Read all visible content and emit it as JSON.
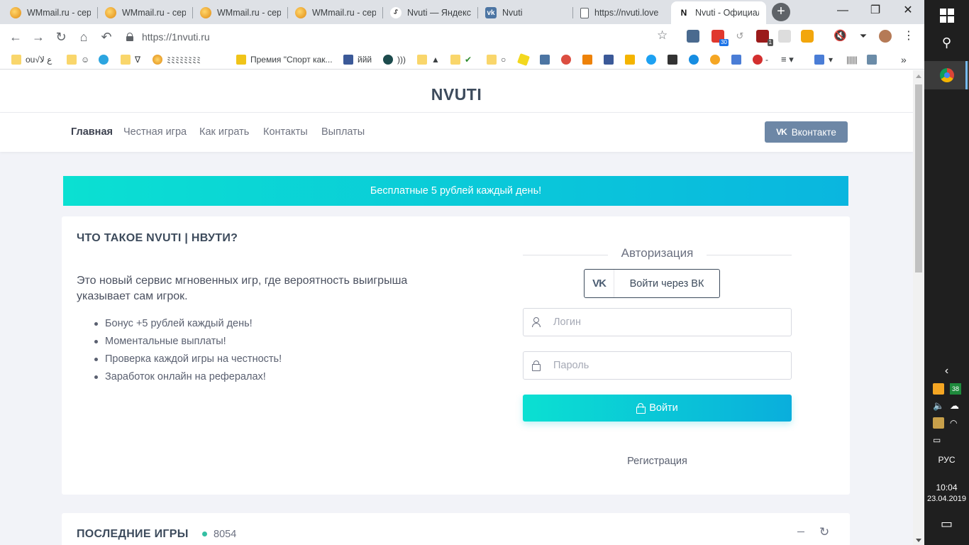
{
  "browser": {
    "tabs": [
      {
        "title": "WMmail.ru - сер",
        "icon": "wmmail-icon"
      },
      {
        "title": "WMmail.ru - сер",
        "icon": "wmmail-icon"
      },
      {
        "title": "WMmail.ru - сер",
        "icon": "wmmail-icon"
      },
      {
        "title": "WMmail.ru - сер",
        "icon": "wmmail-icon"
      },
      {
        "title": "Nvuti — Яндекс",
        "icon": "yandex-icon"
      },
      {
        "title": "Nvuti",
        "icon": "vk-icon"
      },
      {
        "title": "https://nvuti.love",
        "icon": "document-icon"
      },
      {
        "title": "Nvuti - Официал",
        "icon": "nvuti-icon",
        "active": true
      }
    ],
    "new_tab_label": "+",
    "address": "https://1nvuti.ru",
    "extension_badges": {
      "ext2": "30",
      "ext4": "1"
    },
    "bookmarks": [
      {
        "label": "ou√ع ﻻ",
        "icon": "folder-icon"
      },
      {
        "label": "☺",
        "icon": "folder-icon"
      },
      {
        "label": "",
        "icon": "telegram-icon"
      },
      {
        "label": "∇",
        "icon": "folder-icon"
      },
      {
        "label": "ﾐﾐﾐﾐﾐﾐﾐﾐ",
        "icon": "wmmail-icon"
      },
      {
        "label": "Премия \"Спорт как...",
        "icon": "award-icon"
      },
      {
        "label": "ййй",
        "icon": "facebook-icon"
      },
      {
        "label": ")))",
        "icon": "globe-icon"
      },
      {
        "label": "▲",
        "icon": "folder-icon"
      },
      {
        "label": "✔",
        "icon": "folder-icon"
      },
      {
        "label": "○",
        "icon": "folder-icon"
      }
    ]
  },
  "site": {
    "brand": "NVUTI",
    "nav": [
      "Главная",
      "Честная игра",
      "Как играть",
      "Контакты",
      "Выплаты"
    ],
    "vk_button": "Вконтакте",
    "vk_mark": "VK",
    "banner": "Бесплатные 5 рублей каждый день!",
    "about": {
      "title": "ЧТО ТАКОЕ NVUTI | НВУТИ?",
      "intro": "Это новый сервис мгновенных игр, где вероятность выигрыша указывает сам игрок.",
      "features": [
        "Бонус +5 рублей каждый день!",
        "Моментальные выплаты!",
        "Проверка каждой игры на честность!",
        "Заработок онлайн на рефералах!"
      ]
    },
    "auth": {
      "heading": "Авторизация",
      "vk_login": "Войти через ВК",
      "login_placeholder": "Логин",
      "password_placeholder": "Пароль",
      "submit": "Войти",
      "register": "Регистрация"
    },
    "recent_games": {
      "title": "ПОСЛЕДНИЕ ИГРЫ",
      "online_count": "8054"
    }
  },
  "taskbar": {
    "tray_badge": "38",
    "language": "РУС",
    "time": "10:04",
    "date": "23.04.2019"
  },
  "colors": {
    "accent_gradient_start": "#0be0d2",
    "accent_gradient_end": "#0ab6df",
    "vk_button": "#6d87a6",
    "heading_text": "#3d4b5c",
    "online_dot": "#34bfa3"
  }
}
